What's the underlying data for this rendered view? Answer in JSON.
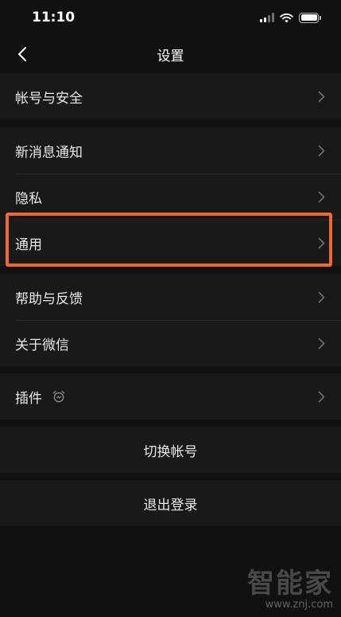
{
  "status_bar": {
    "time": "11:10"
  },
  "nav": {
    "title": "设置"
  },
  "groups": [
    {
      "items": [
        {
          "label": "帐号与安全"
        }
      ]
    },
    {
      "items": [
        {
          "label": "新消息通知"
        },
        {
          "label": "隐私"
        },
        {
          "label": "通用"
        }
      ]
    },
    {
      "items": [
        {
          "label": "帮助与反馈"
        },
        {
          "label": "关于微信"
        }
      ]
    },
    {
      "items": [
        {
          "label": "插件"
        }
      ]
    }
  ],
  "actions": {
    "switch_account": "切换帐号",
    "logout": "退出登录"
  },
  "watermark": {
    "logo": "智能家",
    "url": "www.znj.com"
  },
  "colors": {
    "highlight": "#f0682f",
    "background": "#111111",
    "cell_background": "#191919"
  },
  "icons": {
    "back": "chevron-left-icon",
    "disclosure": "chevron-right-icon",
    "plugin": "alarm-clock-icon"
  }
}
